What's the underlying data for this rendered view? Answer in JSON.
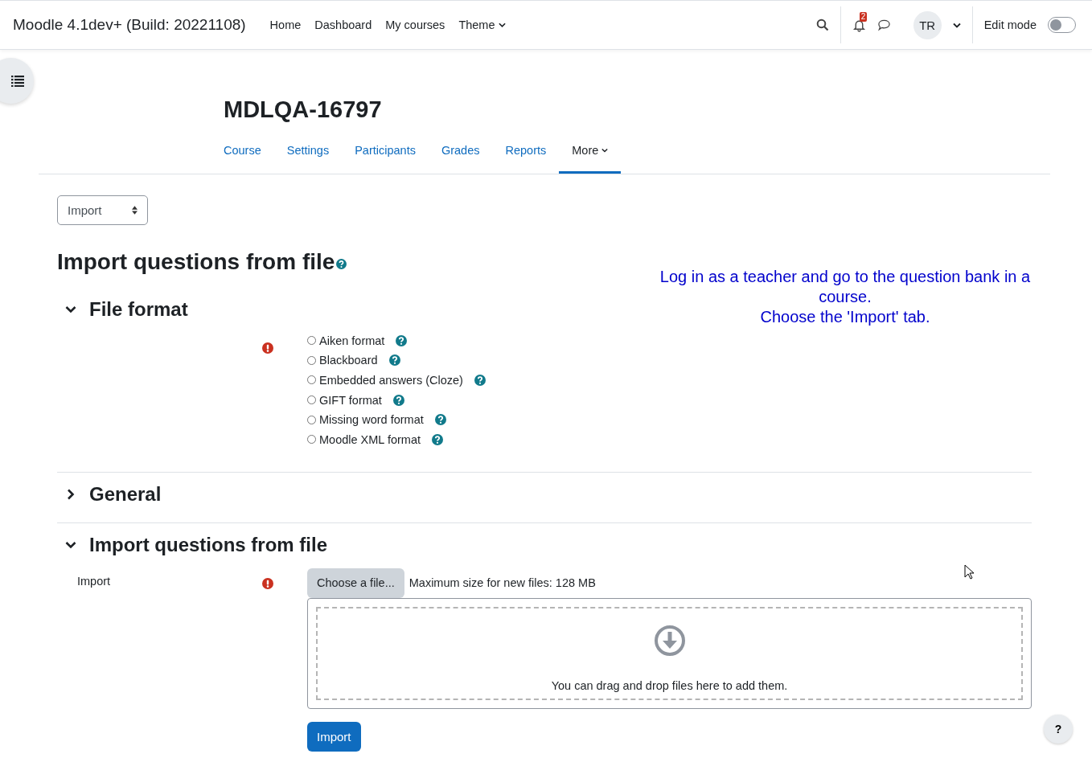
{
  "navbar": {
    "brand": "Moodle 4.1dev+ (Build: 20221108)",
    "links": [
      {
        "label": "Home",
        "dropdown": false
      },
      {
        "label": "Dashboard",
        "dropdown": false
      },
      {
        "label": "My courses",
        "dropdown": false
      },
      {
        "label": "Theme",
        "dropdown": true
      }
    ],
    "notification_count": "2",
    "avatar": "TR",
    "edit_mode": {
      "label": "Edit mode",
      "on": false
    }
  },
  "course": {
    "title": "MDLQA-16797",
    "tabs": [
      {
        "label": "Course",
        "selected": false,
        "dropdown": false
      },
      {
        "label": "Settings",
        "selected": false,
        "dropdown": false
      },
      {
        "label": "Participants",
        "selected": false,
        "dropdown": false
      },
      {
        "label": "Grades",
        "selected": false,
        "dropdown": false
      },
      {
        "label": "Reports",
        "selected": false,
        "dropdown": false
      },
      {
        "label": "More",
        "selected": true,
        "dropdown": true
      }
    ]
  },
  "action_select": {
    "value": "Import"
  },
  "heading": "Import questions from file",
  "note": [
    "Log in as a teacher and go to the question bank in a course.",
    "Choose the 'Import' tab."
  ],
  "sections": [
    {
      "kind": "radios",
      "title": "File format",
      "expanded": true,
      "required": true,
      "options": [
        {
          "label": "Aiken format",
          "selected": false
        },
        {
          "label": "Blackboard",
          "selected": false
        },
        {
          "label": "Embedded answers (Cloze)",
          "selected": false
        },
        {
          "label": "GIFT format",
          "selected": false
        },
        {
          "label": "Missing word format",
          "selected": false
        },
        {
          "label": "Moodle XML format",
          "selected": false
        }
      ]
    },
    {
      "kind": "empty",
      "title": "General",
      "expanded": false
    },
    {
      "kind": "file",
      "title": "Import questions from file",
      "expanded": true,
      "required": true,
      "label": "Import",
      "choose_button": "Choose a file...",
      "max_size": "Maximum size for new files: 128 MB",
      "drop_hint": "You can drag and drop files here to add them."
    }
  ],
  "submit_button": "Import",
  "help_button": "?"
}
